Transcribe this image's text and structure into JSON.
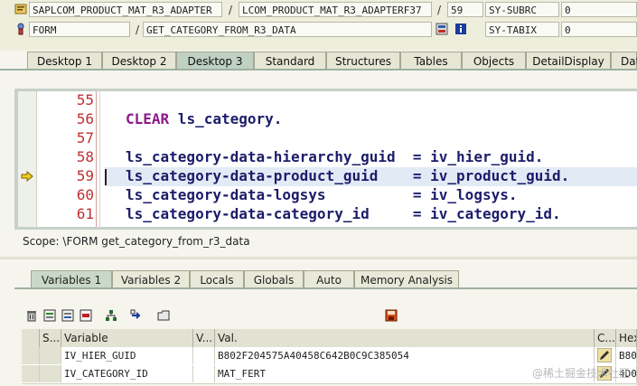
{
  "info": {
    "row1": {
      "program": "SAPLCOM_PRODUCT_MAT_R3_ADAPTER",
      "include": "LCOM_PRODUCT_MAT_R3_ADAPTERF37",
      "line": "59",
      "sysfield": "SY-SUBRC",
      "sysvalue": "0"
    },
    "row2": {
      "type": "FORM",
      "name": "GET_CATEGORY_FROM_R3_DATA",
      "sysfield": "SY-TABIX",
      "sysvalue": "0"
    },
    "sep": "/"
  },
  "tabs": [
    "Desktop 1",
    "Desktop 2",
    "Desktop 3",
    "Standard",
    "Structures",
    "Tables",
    "Objects",
    "DetailDisplay",
    "Dat"
  ],
  "editor": {
    "lines": [
      {
        "num": "55",
        "keyword": "",
        "text": ""
      },
      {
        "num": "56",
        "keyword": "CLEAR",
        "text": " ls_category."
      },
      {
        "num": "57",
        "keyword": "",
        "text": ""
      },
      {
        "num": "58",
        "keyword": "",
        "text": "ls_category-data-hierarchy_guid  = iv_hier_guid."
      },
      {
        "num": "59",
        "keyword": "",
        "text": "ls_category-data-product_guid    = iv_product_guid."
      },
      {
        "num": "60",
        "keyword": "",
        "text": "ls_category-data-logsys          = iv_logsys."
      },
      {
        "num": "61",
        "keyword": "",
        "text": "ls_category-data-category_id     = iv_category_id."
      }
    ],
    "current_line": "59"
  },
  "scope": "Scope: \\FORM get_category_from_r3_data",
  "bottom_tabs": [
    "Variables 1",
    "Variables 2",
    "Locals",
    "Globals",
    "Auto",
    "Memory Analysis"
  ],
  "table": {
    "headers": [
      "S...",
      "Variable",
      "V...",
      "Val.",
      "C...",
      "Hex"
    ],
    "rows": [
      {
        "variable": "IV_HIER_GUID",
        "value": "B802F204575A40458C642B0C9C385054",
        "hex": "B80"
      },
      {
        "variable": "IV_CATEGORY_ID",
        "value": "MAT_FERT",
        "hex": "4D0"
      }
    ]
  },
  "watermark": "@稀土掘金技术社区",
  "colors": {
    "keyword": "#8b1a8b",
    "code": "#1c1c6a",
    "line_number": "#c03030",
    "active_tab": "#bfd1c2"
  },
  "icons": [
    "program-icon",
    "form-icon",
    "breakpoint-icon",
    "info-icon",
    "delete-icon",
    "export-icon",
    "save-icon"
  ]
}
